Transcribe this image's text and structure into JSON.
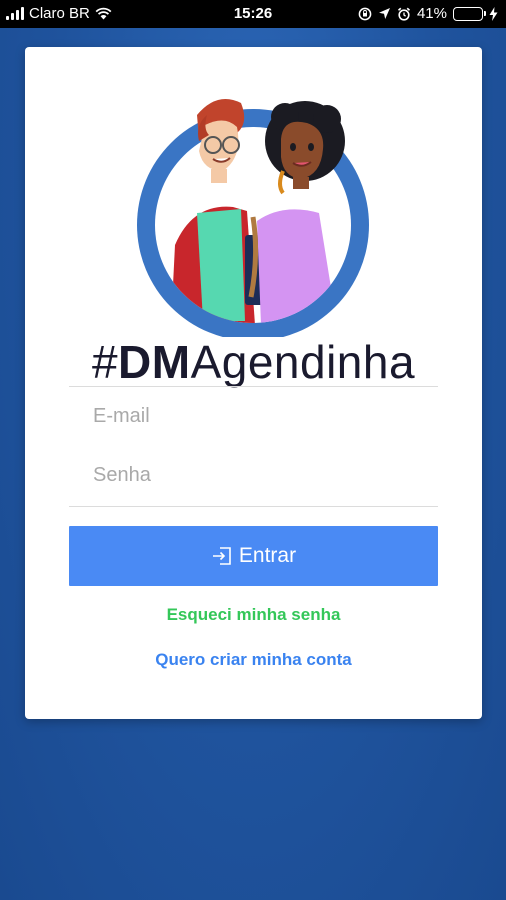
{
  "status_bar": {
    "carrier": "Claro BR",
    "time": "15:26",
    "battery_percent": "41%",
    "battery_level": 0.41,
    "icons": [
      "signal-icon",
      "wifi-icon",
      "orientation-lock-icon",
      "location-icon",
      "alarm-icon",
      "battery-icon",
      "charging-icon"
    ]
  },
  "login": {
    "brand": {
      "hash": "#",
      "dm": "DM",
      "rest": "Agendinha"
    },
    "email_placeholder": "E-mail",
    "email_value": "",
    "password_placeholder": "Senha",
    "password_value": "",
    "submit_label": "Entrar",
    "forgot_label": "Esqueci minha senha",
    "create_label": "Quero criar minha conta"
  },
  "colors": {
    "background": "#1f539d",
    "primary_button": "#4a8af4",
    "forgot_link": "#34c759",
    "create_link": "#3a83f0",
    "logo_ring": "#3a75c4"
  }
}
